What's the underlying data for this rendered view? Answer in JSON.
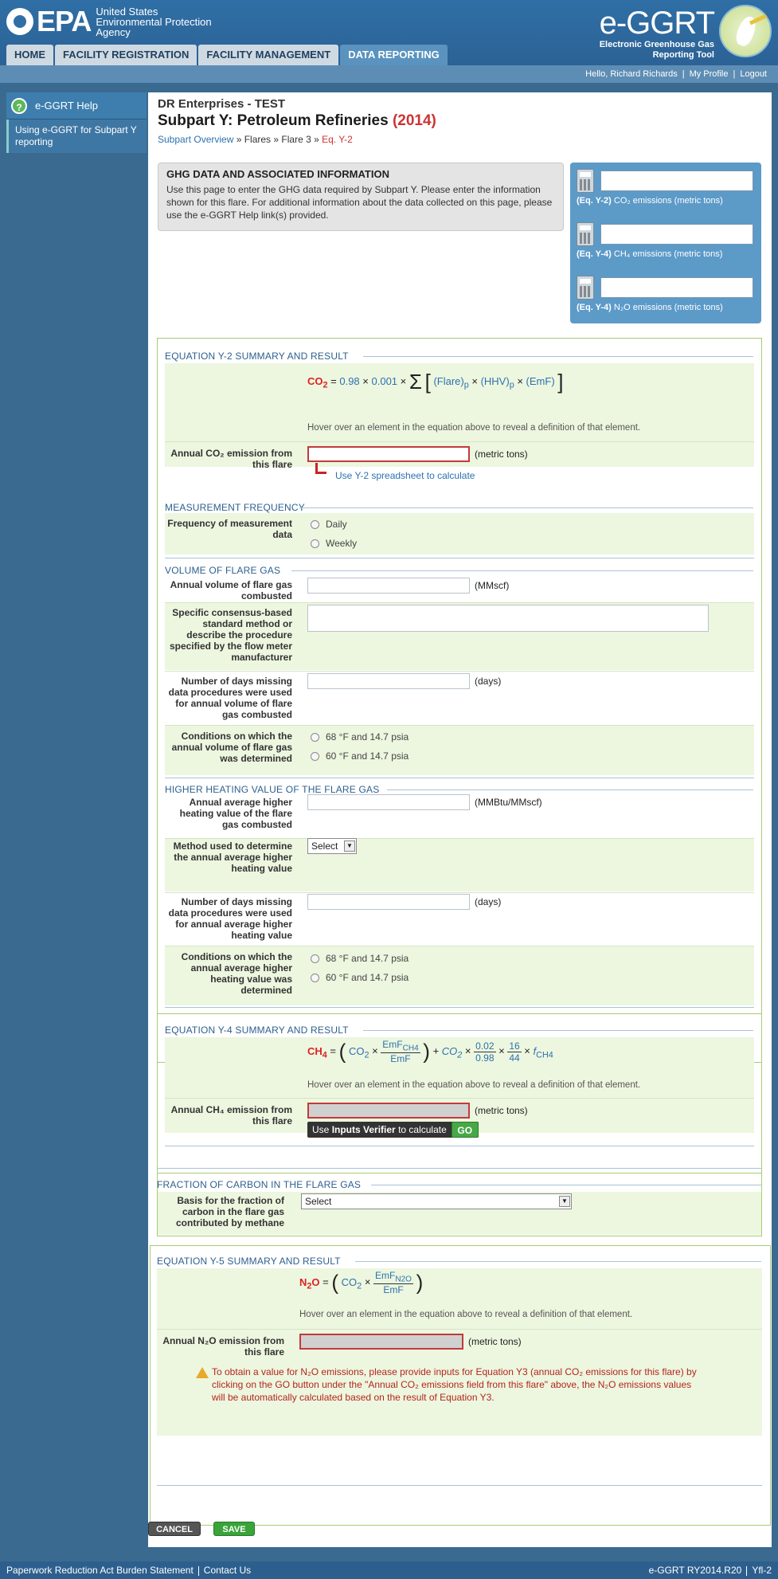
{
  "header": {
    "epa_word": "EPA",
    "agency_lines": [
      "United States",
      "Environmental Protection",
      "Agency"
    ],
    "brand_title": "e-GGRT",
    "brand_sub_lines": [
      "Electronic Greenhouse Gas",
      "Reporting Tool"
    ]
  },
  "nav": {
    "tabs": [
      "HOME",
      "FACILITY REGISTRATION",
      "FACILITY MANAGEMENT",
      "DATA REPORTING"
    ]
  },
  "user_bar": {
    "greeting": "Hello, Richard Richards",
    "profile": "My Profile",
    "logout": "Logout"
  },
  "sidebar": {
    "help_title": "e-GGRT Help",
    "help_link": "Using e-GGRT for Subpart Y reporting"
  },
  "page": {
    "facility": "DR Enterprises - TEST",
    "title": "Subpart Y: Petroleum Refineries",
    "year": "(2014)",
    "crumbs": {
      "overview": "Subpart Overview",
      "flares": "Flares",
      "flare": "Flare 3",
      "current": "Eq. Y-2"
    }
  },
  "ghg_box": {
    "heading": "GHG DATA AND ASSOCIATED INFORMATION",
    "text": "Use this page to enter the GHG data required by Subpart Y. Please enter the information shown for this flare. For additional information about the data collected on this page, please use the e-GGRT Help link(s) provided."
  },
  "calc_panel": [
    {
      "eq": "(Eq. Y-2)",
      "gas": "CO₂",
      "suffix": "emissions (metric tons)"
    },
    {
      "eq": "(Eq. Y-4)",
      "gas": "CH₄",
      "suffix": "emissions (metric tons)"
    },
    {
      "eq": "(Eq. Y-4)",
      "gas": "N₂O",
      "suffix": "emissions (metric tons)"
    }
  ],
  "eq_y2": {
    "heading": "EQUATION Y-2 SUMMARY AND RESULT",
    "hint": "Hover over an element in the equation above to reveal a definition of that element.",
    "label": "Annual CO₂ emission from this flare",
    "unit": "(metric tons)",
    "link": "Use Y-2 spreadsheet to calculate"
  },
  "measurement": {
    "heading": "MEASUREMENT FREQUENCY",
    "label": "Frequency of measurement data",
    "options": [
      "Daily",
      "Weekly"
    ]
  },
  "volume": {
    "heading": "VOLUME OF FLARE GAS",
    "annual_label": "Annual volume of flare gas combusted",
    "annual_unit": "(MMscf)",
    "method_label": "Specific consensus-based standard method or describe the procedure specified by the flow meter manufacturer",
    "days_label": "Number of days missing data procedures were used for annual volume of flare gas combusted",
    "days_unit": "(days)",
    "cond_label": "Conditions on which the annual volume of flare gas was determined",
    "cond_options": [
      "68 °F and 14.7 psia",
      "60 °F and 14.7 psia"
    ]
  },
  "hhv": {
    "heading": "HIGHER HEATING VALUE OF THE FLARE GAS",
    "annual_label": "Annual average higher heating value of the flare gas combusted",
    "annual_unit": "(MMBtu/MMscf)",
    "method_label": "Method used to determine the annual average higher heating value",
    "method_select": "Select",
    "days_label": "Number of days missing data procedures were used for annual average higher heating value",
    "days_unit": "(days)",
    "cond_label": "Conditions on which the annual average higher heating value was determined",
    "cond_options": [
      "68 °F and 14.7 psia",
      "60 °F and 14.7 psia"
    ]
  },
  "eq_y4": {
    "heading": "EQUATION Y-4 SUMMARY AND RESULT",
    "hint": "Hover over an element in the equation above to reveal a definition of that element.",
    "label": "Annual CH₄ emission from this flare",
    "unit": "(metric tons)",
    "verifier_pre": "Use",
    "verifier_bold": "Inputs Verifier",
    "verifier_post": "to calculate",
    "go": "GO"
  },
  "fraction": {
    "heading": "FRACTION OF CARBON IN THE FLARE GAS",
    "label": "Basis for the fraction of carbon in the flare gas contributed by methane",
    "select": "Select"
  },
  "eq_y5": {
    "heading": "EQUATION Y-5 SUMMARY AND RESULT",
    "hint": "Hover over an element in the equation above to reveal a definition of that element.",
    "label": "Annual N₂O emission from this flare",
    "unit": "(metric tons)",
    "warning": "To obtain a value for N₂O emissions, please provide inputs for Equation Y3 (annual CO₂ emissions for this flare) by clicking on the GO button under the \"Annual CO₂ emissions field from this flare\" above, the N₂O emissions values will be automatically calculated based on the result of Equation Y3."
  },
  "buttons": {
    "cancel": "CANCEL",
    "save": "SAVE"
  },
  "footer": {
    "prra": "Paperwork Reduction Act Burden Statement",
    "contact": "Contact Us",
    "version": "e-GGRT RY2014.R20",
    "page_id": "Yfl-2"
  }
}
